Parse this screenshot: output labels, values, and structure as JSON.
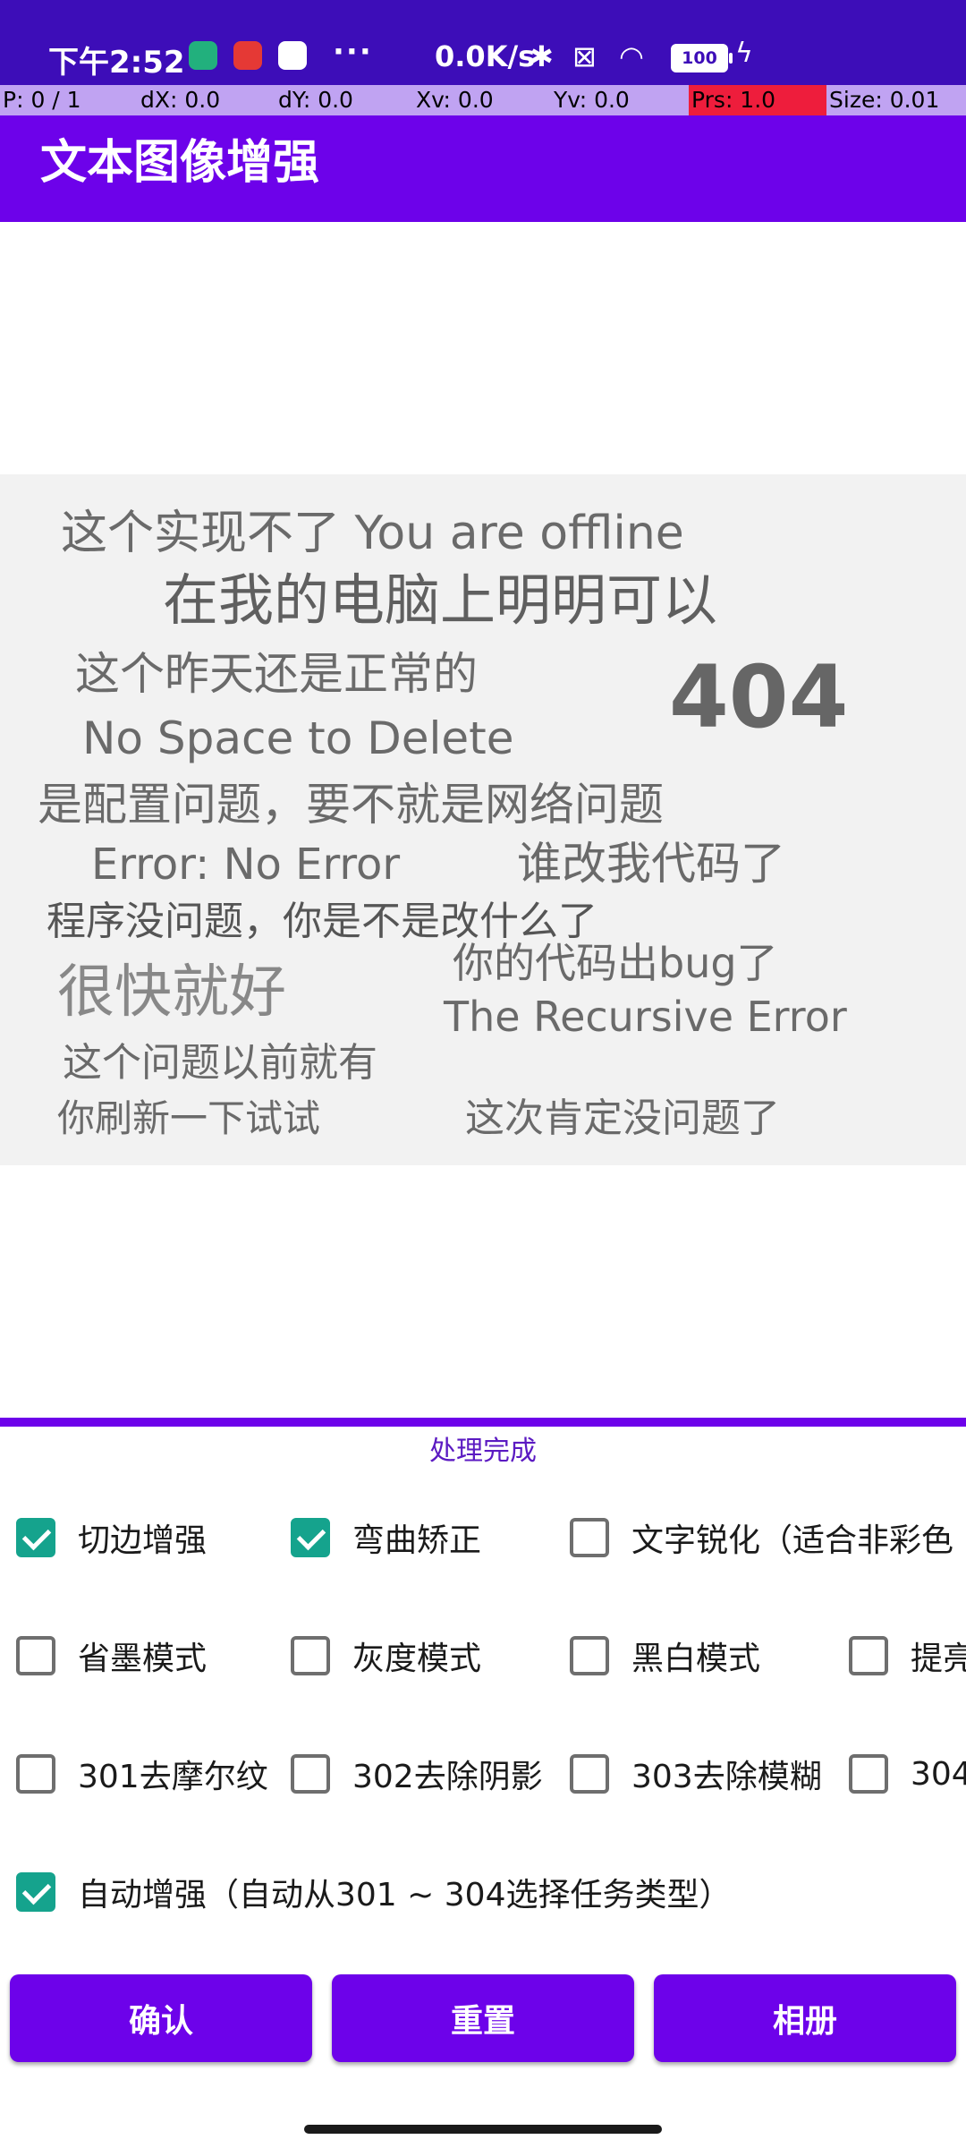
{
  "status_bar": {
    "time": "下午2:52",
    "more": "···",
    "net_speed": "0.0K/s",
    "battery": "100"
  },
  "pointer_bar": [
    "P: 0 / 1",
    "dX: 0.0",
    "dY: 0.0",
    "Xv: 0.0",
    "Yv: 0.0",
    "Prs: 1.0",
    "Size: 0.01"
  ],
  "app_bar": {
    "title": "文本图像增强"
  },
  "image": {
    "lines": [
      "这个实现不了 You are offline",
      "在我的电脑上明明可以",
      "这个昨天还是正常的",
      "404",
      "No Space to Delete",
      "是配置问题，要不就是网络问题",
      "Error: No Error",
      "谁改我代码了",
      "程序没问题，你是不是改什么了",
      "很快就好",
      "你的代码出bug了",
      "The Recursive Error",
      "这个问题以前就有",
      "你刷新一下试试",
      "这次肯定没问题了"
    ]
  },
  "status_text": "处理完成",
  "options": [
    {
      "label": "切边增强",
      "checked": true
    },
    {
      "label": "弯曲矫正",
      "checked": true
    },
    {
      "label": "文字锐化（适合非彩色",
      "checked": false
    },
    {
      "label": "省墨模式",
      "checked": false
    },
    {
      "label": "灰度模式",
      "checked": false
    },
    {
      "label": "黑白模式",
      "checked": false
    },
    {
      "label": "提亮",
      "checked": false
    },
    {
      "label": "301去摩尔纹",
      "checked": false
    },
    {
      "label": "302去除阴影",
      "checked": false
    },
    {
      "label": "303去除模糊",
      "checked": false
    },
    {
      "label": "304",
      "checked": false
    },
    {
      "label": "自动增强（自动从301 ~ 304选择任务类型）",
      "checked": true
    }
  ],
  "buttons": {
    "confirm": "确认",
    "reset": "重置",
    "album": "相册"
  },
  "colors": {
    "primary": "#6d02ea",
    "status_bar": "#3d0db8",
    "checkbox_checked": "#15a38d",
    "status_text": "#5b1ac2"
  }
}
